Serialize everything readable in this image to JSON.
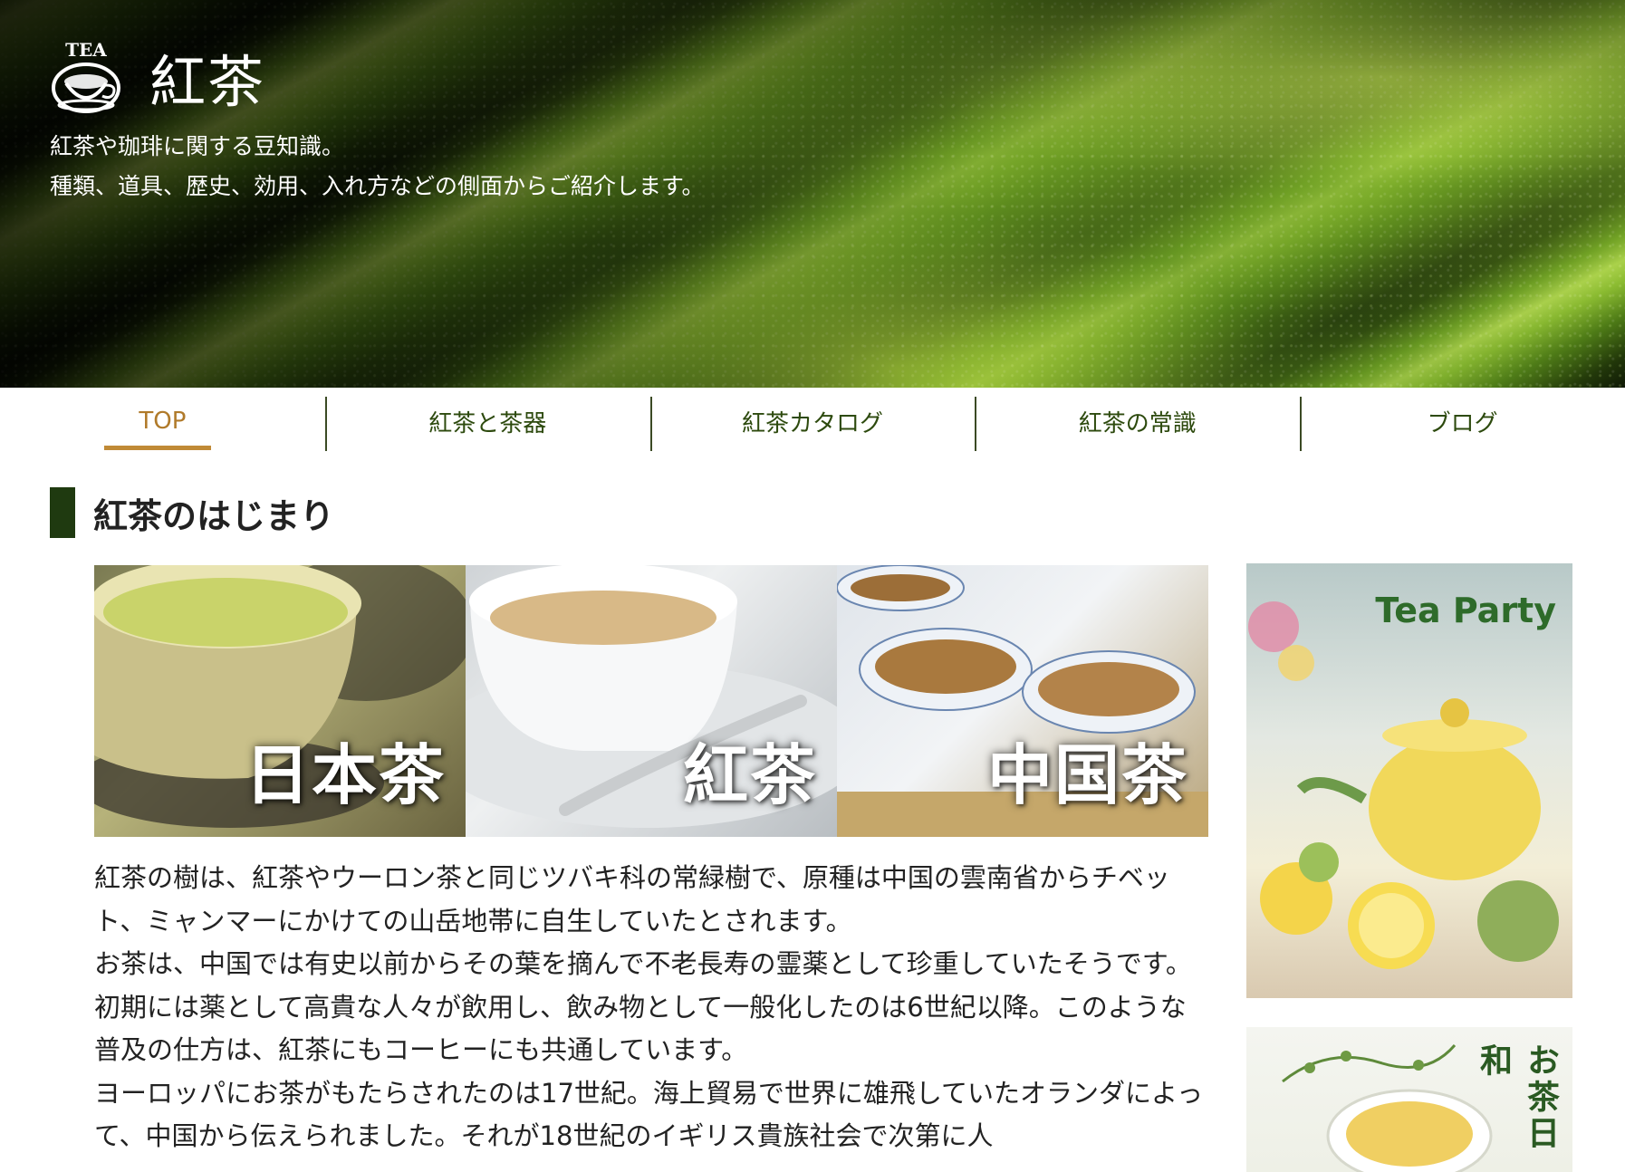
{
  "header": {
    "site_title": "紅茶",
    "logo_text": "TEA",
    "tagline_line1": "紅茶や珈琲に関する豆知識。",
    "tagline_line2": "種類、道具、歴史、効用、入れ方などの側面からご紹介します。"
  },
  "nav": {
    "items": [
      {
        "label": "TOP"
      },
      {
        "label": "紅茶と茶器"
      },
      {
        "label": "紅茶カタログ"
      },
      {
        "label": "紅茶の常識"
      },
      {
        "label": "ブログ"
      }
    ],
    "active_index": 0
  },
  "main": {
    "section_title": "紅茶のはじまり",
    "tea_images": [
      {
        "label": "日本茶"
      },
      {
        "label": "紅茶"
      },
      {
        "label": "中国茶"
      }
    ],
    "paragraphs": [
      "紅茶の樹は、紅茶やウーロン茶と同じツバキ科の常緑樹で、原種は中国の雲南省からチベット、ミャンマーにかけての山岳地帯に自生していたとされます。",
      "お茶は、中国では有史以前からその葉を摘んで不老長寿の霊薬として珍重していたそうです。初期には薬として高貴な人々が飲用し、飲み物として一般化したのは6世紀以降。このような普及の仕方は、紅茶にもコーヒーにも共通しています。",
      "ヨーロッパにお茶がもたらされたのは17世紀。海上貿易で世界に雄飛していたオランダによって、中国から伝えられました。それが18世紀のイギリス貴族社会で次第に人"
    ]
  },
  "sidebar": {
    "banners": [
      {
        "title": "Tea Party"
      },
      {
        "title": "お茶日和"
      }
    ]
  },
  "colors": {
    "nav_text": "#2d4a0e",
    "nav_active": "#b07a2a",
    "heading_bar": "#1f3a10"
  }
}
